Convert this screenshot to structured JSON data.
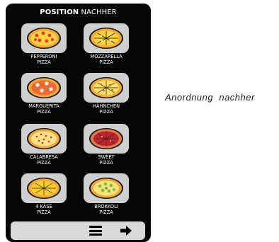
{
  "screen": {
    "title_strong": "POSITION",
    "title_rest": "NACHHER",
    "pizzas": [
      {
        "line1": "PEPPERONI",
        "line2": "PIZZA",
        "icon": "pepperoni-pizza-icon"
      },
      {
        "line1": "MOZZARELLA",
        "line2": "PIZZA",
        "icon": "mozzarella-pizza-icon"
      },
      {
        "line1": "MARGUERITA",
        "line2": "PIZZA",
        "icon": "marguerita-pizza-icon"
      },
      {
        "line1": "HÄHNCHEN",
        "line2": "PIZZA",
        "icon": "haehnchen-pizza-icon"
      },
      {
        "line1": "CALABRESA",
        "line2": "PIZZA",
        "icon": "calabresa-pizza-icon"
      },
      {
        "line1": "SWEET",
        "line2": "PIZZA",
        "icon": "sweet-pizza-icon"
      },
      {
        "line1": "4 KÄSE",
        "line2": "PIZZA",
        "icon": "4-kaese-pizza-icon"
      },
      {
        "line1": "BROKKOLI",
        "line2": "PIZZA",
        "icon": "brokkoli-pizza-icon"
      }
    ],
    "toolbar": {
      "menu_icon": "menu-icon",
      "next_icon": "arrow-right-icon"
    }
  },
  "caption": "Anordnung  nachher",
  "colors": {
    "device_bg": "#050505",
    "tile_bg": "#cfcfcf",
    "toolbar_bg": "#d9d9d9",
    "crust": "#f2a93b",
    "cheese": "#ffd23f",
    "sauce_red": "#d9452b",
    "sweet_red": "#b8292f",
    "broccoli": "#6fbf4a"
  }
}
